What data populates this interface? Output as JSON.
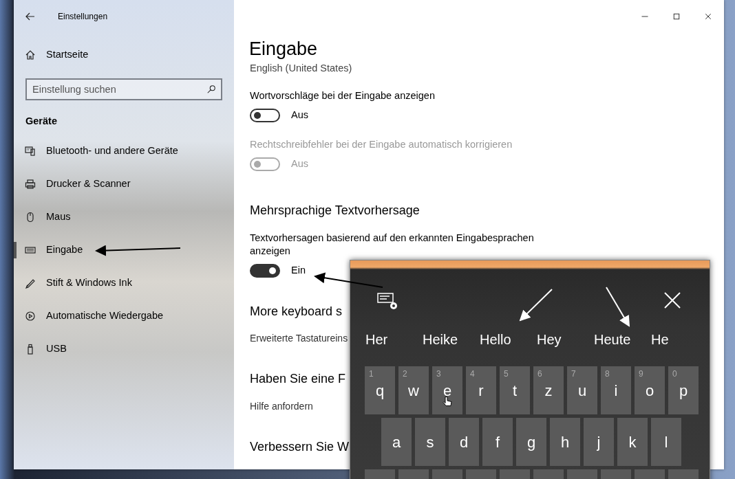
{
  "window": {
    "title": "Einstellungen"
  },
  "sidebar": {
    "home": "Startseite",
    "search": {
      "placeholder": "Einstellung suchen"
    },
    "section": "Geräte",
    "items": [
      {
        "label": "Bluetooth- und andere Geräte",
        "selected": false
      },
      {
        "label": "Drucker & Scanner",
        "selected": false
      },
      {
        "label": "Maus",
        "selected": false
      },
      {
        "label": "Eingabe",
        "selected": true
      },
      {
        "label": "Stift & Windows Ink",
        "selected": false
      },
      {
        "label": "Automatische Wiedergabe",
        "selected": false
      },
      {
        "label": "USB",
        "selected": false
      }
    ]
  },
  "main": {
    "title": "Eingabe",
    "content": [
      {
        "kind": "text",
        "text": "English (United States)"
      },
      {
        "kind": "toggle",
        "label": "Wortvorschläge bei der Eingabe anzeigen",
        "on": false,
        "disabled": false,
        "state": "Aus"
      },
      {
        "kind": "toggle",
        "label": "Rechtschreibfehler bei der Eingabe automatisch korrigieren",
        "on": false,
        "disabled": true,
        "state": "Aus"
      },
      {
        "kind": "heading",
        "text": "Mehrsprachige Textvorhersage"
      },
      {
        "kind": "toggle",
        "label": "Textvorhersagen basierend auf den erkannten Eingabesprachen anzeigen",
        "on": true,
        "disabled": false,
        "state": "Ein"
      },
      {
        "kind": "heading",
        "text": "More keyboard s"
      },
      {
        "kind": "link",
        "text": "Erweiterte Tastatureins"
      },
      {
        "kind": "heading",
        "text": "Haben Sie eine F"
      },
      {
        "kind": "link",
        "text": "Hilfe anfordern"
      },
      {
        "kind": "heading",
        "text": "Verbessern Sie W"
      }
    ]
  },
  "keyboard": {
    "suggestions": [
      "Her",
      "Heike",
      "Hello",
      "Hey",
      "Heute",
      "He"
    ],
    "rows": [
      [
        {
          "hint": "1",
          "key": "q"
        },
        {
          "hint": "2",
          "key": "w"
        },
        {
          "hint": "3",
          "key": "e"
        },
        {
          "hint": "4",
          "key": "r"
        },
        {
          "hint": "5",
          "key": "t"
        },
        {
          "hint": "6",
          "key": "z"
        },
        {
          "hint": "7",
          "key": "u"
        },
        {
          "hint": "8",
          "key": "i"
        },
        {
          "hint": "9",
          "key": "o"
        },
        {
          "hint": "0",
          "key": "p"
        }
      ],
      [
        {
          "key": "a"
        },
        {
          "key": "s"
        },
        {
          "key": "d"
        },
        {
          "key": "f"
        },
        {
          "key": "g"
        },
        {
          "key": "h"
        },
        {
          "key": "j"
        },
        {
          "key": "k"
        },
        {
          "key": "l"
        }
      ]
    ]
  }
}
